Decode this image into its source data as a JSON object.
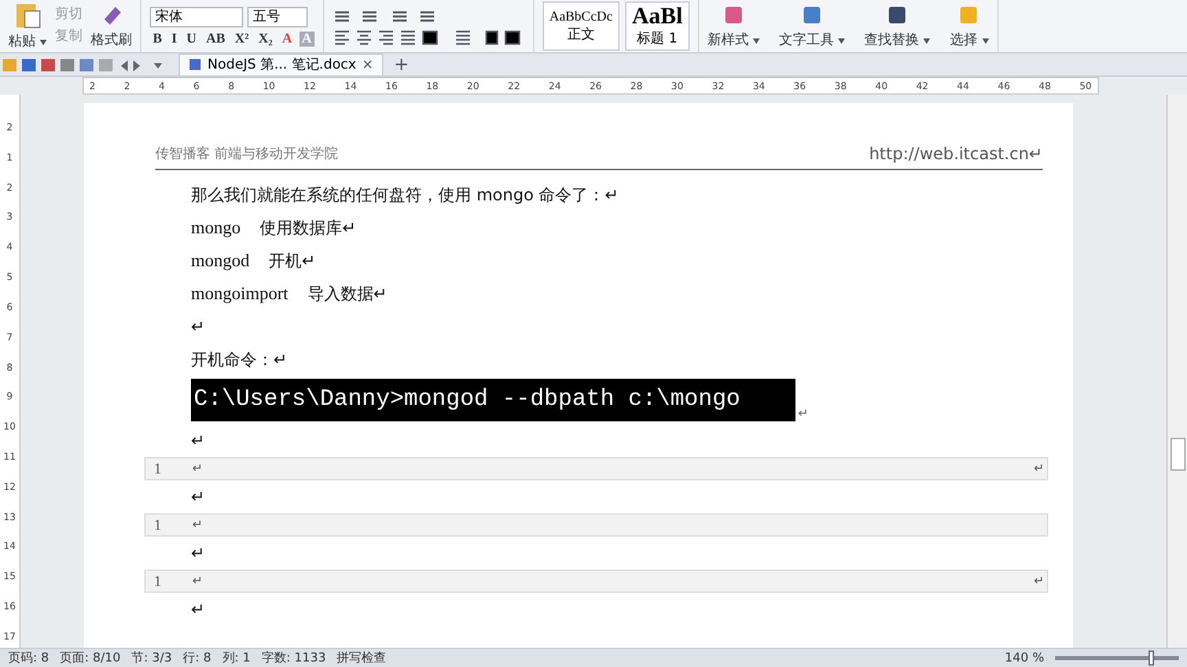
{
  "ribbon": {
    "clipboard": {
      "paste": "粘贴",
      "cut": "剪切",
      "copy": "复制",
      "format_painter": "格式刷"
    },
    "font": {
      "family": "宋体",
      "size": "五号",
      "buttons": [
        "B",
        "I",
        "U",
        "AB",
        "X²",
        "X₂",
        "A",
        "A"
      ]
    },
    "styles": [
      {
        "preview": "AaBbCcDc",
        "label": "正文",
        "kind": "small"
      },
      {
        "preview": "AaBl",
        "label": "标题 1",
        "kind": "big"
      }
    ],
    "tools": [
      "新样式",
      "文字工具",
      "查找替换",
      "选择"
    ]
  },
  "tab": {
    "title": "NodeJS 第... 笔记.docx",
    "close": "×",
    "add": "+"
  },
  "ruler": {
    "marks": [
      "2",
      "2",
      "4",
      "6",
      "8",
      "10",
      "12",
      "14",
      "16",
      "18",
      "20",
      "22",
      "24",
      "26",
      "28",
      "30",
      "32",
      "34",
      "36",
      "38",
      "40",
      "42",
      "44",
      "46",
      "48",
      "50"
    ]
  },
  "vruler": [
    "2",
    "1",
    "2",
    "3",
    "4",
    "5",
    "6",
    "7",
    "8",
    "9",
    "10",
    "11",
    "12",
    "13",
    "14",
    "15",
    "16",
    "17"
  ],
  "header": {
    "left": "传智播客 前端与移动开发学院",
    "right": "http://web.itcast.cn↵"
  },
  "body": [
    {
      "kind": "text",
      "text": "那么我们就能在系统的任何盘符，使用 mongo 命令了：↵"
    },
    {
      "kind": "pair",
      "a": "mongo",
      "b": "使用数据库↵"
    },
    {
      "kind": "pair",
      "a": "mongod",
      "b": "开机↵"
    },
    {
      "kind": "pair",
      "a": "mongoimport",
      "b": "导入数据↵"
    },
    {
      "kind": "text",
      "text": "↵"
    },
    {
      "kind": "text",
      "text": "开机命令：↵"
    },
    {
      "kind": "console",
      "text": "C:\\Users\\Danny>mongod --dbpath c:\\mongo",
      "mark": "↵"
    },
    {
      "kind": "text",
      "text": "↵"
    },
    {
      "kind": "code",
      "num": "1",
      "text": "↵",
      "end": "↵"
    },
    {
      "kind": "text",
      "text": "↵"
    },
    {
      "kind": "code",
      "num": "1",
      "text": "↵"
    },
    {
      "kind": "text",
      "text": "↵"
    },
    {
      "kind": "code",
      "num": "1",
      "text": "↵",
      "end": "↵"
    },
    {
      "kind": "text",
      "text": "↵"
    }
  ],
  "status_bar": {
    "items": [
      "页码: 8",
      "页面: 8/10",
      "节: 3/3",
      "行: 8",
      "列: 1",
      "字数: 1133",
      "拼写检查"
    ],
    "zoom": "140 %",
    "zoom_slider": {
      "level": 0.78
    }
  }
}
